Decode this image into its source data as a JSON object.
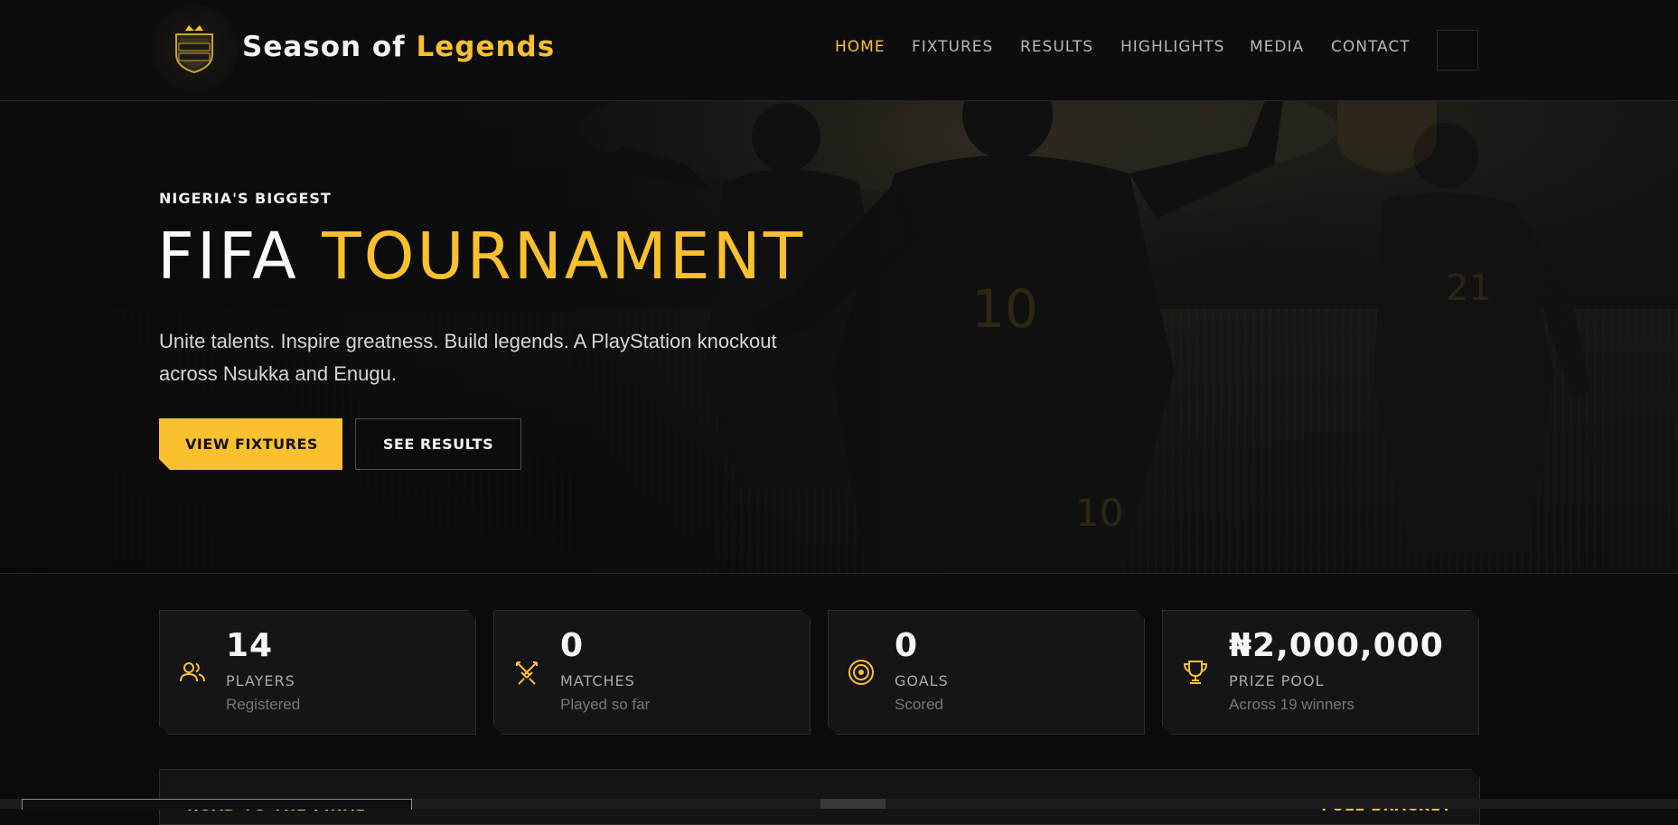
{
  "brand": {
    "logo_text": "SEASON LEGENDS",
    "name_prefix": "Season of ",
    "name_accent": "Legends"
  },
  "nav": {
    "items": [
      {
        "label": "HOME",
        "active": true
      },
      {
        "label": "FIXTURES",
        "active": false
      },
      {
        "label": "RESULTS",
        "active": false
      },
      {
        "label": "HIGHLIGHTS",
        "active": false
      },
      {
        "label": "MEDIA",
        "active": false
      },
      {
        "label": "CONTACT",
        "active": false
      }
    ]
  },
  "hero": {
    "eyebrow": "NIGERIA'S BIGGEST",
    "headline_white": "FIFA ",
    "headline_accent": "TOURNAMENT",
    "subtitle": "Unite talents. Inspire greatness. Build legends. A PlayStation knockout across Nsukka and Enugu.",
    "primary_button": "VIEW FIXTURES",
    "secondary_button": "SEE RESULTS",
    "jersey_numbers": [
      "10",
      "21"
    ]
  },
  "stats": [
    {
      "icon": "users-icon",
      "value": "14",
      "label": "PLAYERS",
      "sub": "Registered"
    },
    {
      "icon": "crossed-swords-icon",
      "value": "0",
      "label": "MATCHES",
      "sub": "Played so far"
    },
    {
      "icon": "target-icon",
      "value": "0",
      "label": "GOALS",
      "sub": "Scored"
    },
    {
      "icon": "trophy-icon",
      "value": "₦2,000,000",
      "label": "PRIZE POOL",
      "sub": "Across 19 winners"
    }
  ],
  "road": {
    "title": "ROAD TO THE FINAL",
    "link": "FULL BRACKET"
  },
  "colors": {
    "accent": "#fbc02d",
    "background": "#0b0b0d",
    "card": "#151518"
  }
}
